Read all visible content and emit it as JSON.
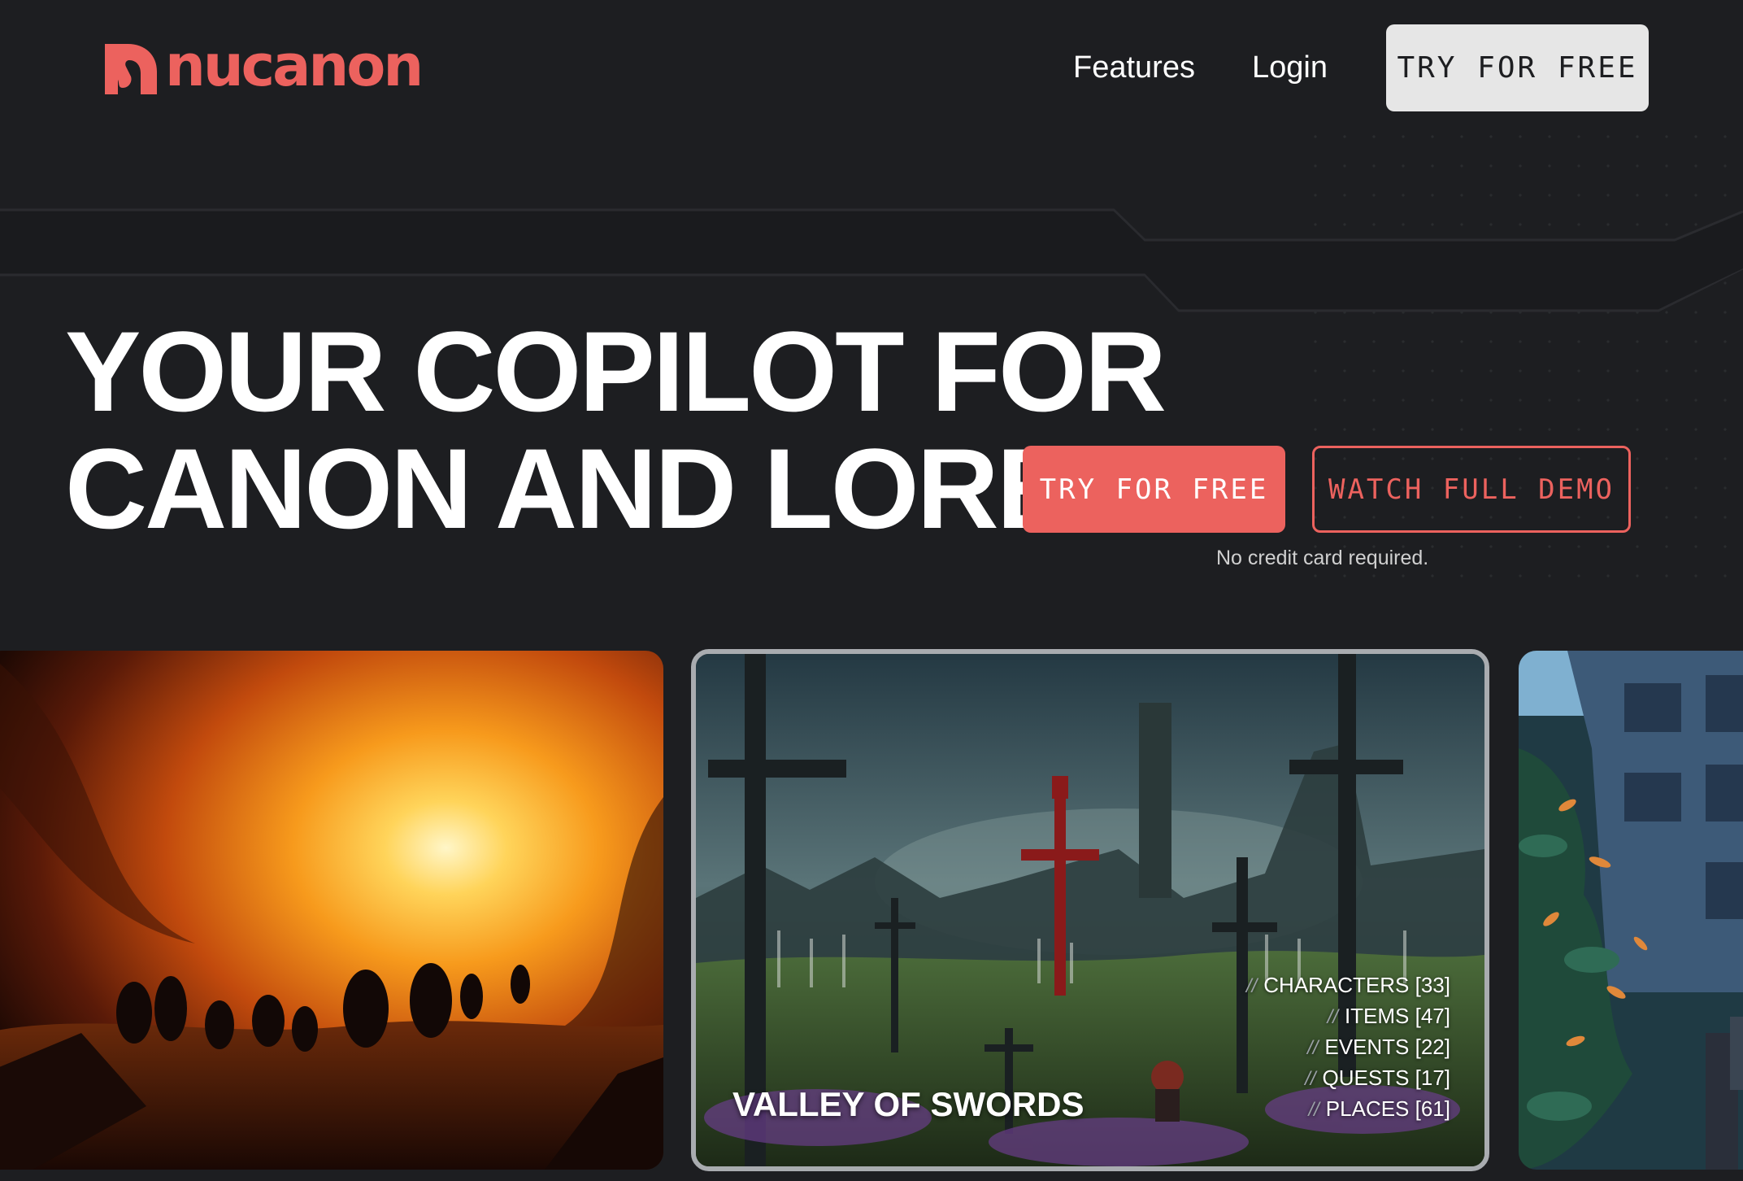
{
  "brand": {
    "name": "nucanon",
    "accent": "#ec625e"
  },
  "nav": {
    "features": "Features",
    "login": "Login",
    "cta": "TRY FOR FREE"
  },
  "hero": {
    "title_line1": "YOUR COPILOT FOR",
    "title_line2": "CANON AND LORE.",
    "primary_cta": "TRY FOR FREE",
    "secondary_cta": "WATCH FULL DEMO",
    "note": "No credit card required."
  },
  "cards": {
    "left": {
      "image": "fiery-vortex-warriors-illustration"
    },
    "center": {
      "image": "graveyard-of-swords-illustration",
      "title": "VALLEY OF SWORDS",
      "stats": [
        {
          "label": "CHARACTERS [33]"
        },
        {
          "label": "ITEMS [47]"
        },
        {
          "label": "EVENTS [22]"
        },
        {
          "label": "QUESTS [17]"
        },
        {
          "label": "PLACES [61]"
        }
      ]
    },
    "right": {
      "image": "overgrown-city-building-illustration"
    }
  },
  "colors": {
    "background": "#1d1e21",
    "button_light": "#e6e6e6",
    "card_border": "#a9acb0"
  }
}
